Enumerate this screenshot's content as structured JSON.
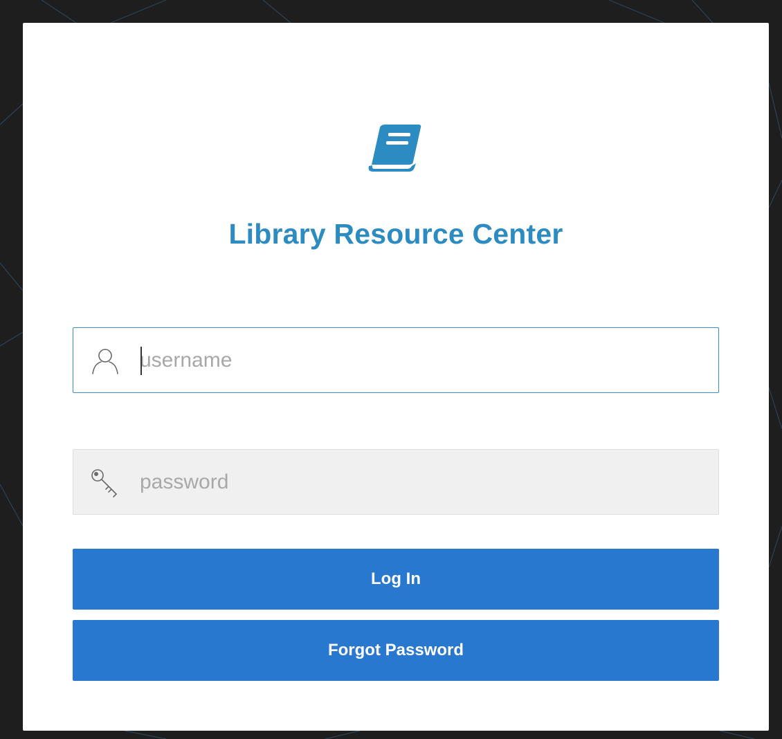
{
  "app": {
    "title": "Library Resource Center",
    "accent_color": "#2c8cc2",
    "button_color": "#2878d0",
    "logo_icon": "book-icon"
  },
  "login_form": {
    "username": {
      "placeholder": "username",
      "value": "",
      "icon": "user-icon"
    },
    "password": {
      "placeholder": "password",
      "value": "",
      "icon": "key-icon"
    },
    "login_button_label": "Log In",
    "forgot_password_label": "Forgot Password"
  }
}
